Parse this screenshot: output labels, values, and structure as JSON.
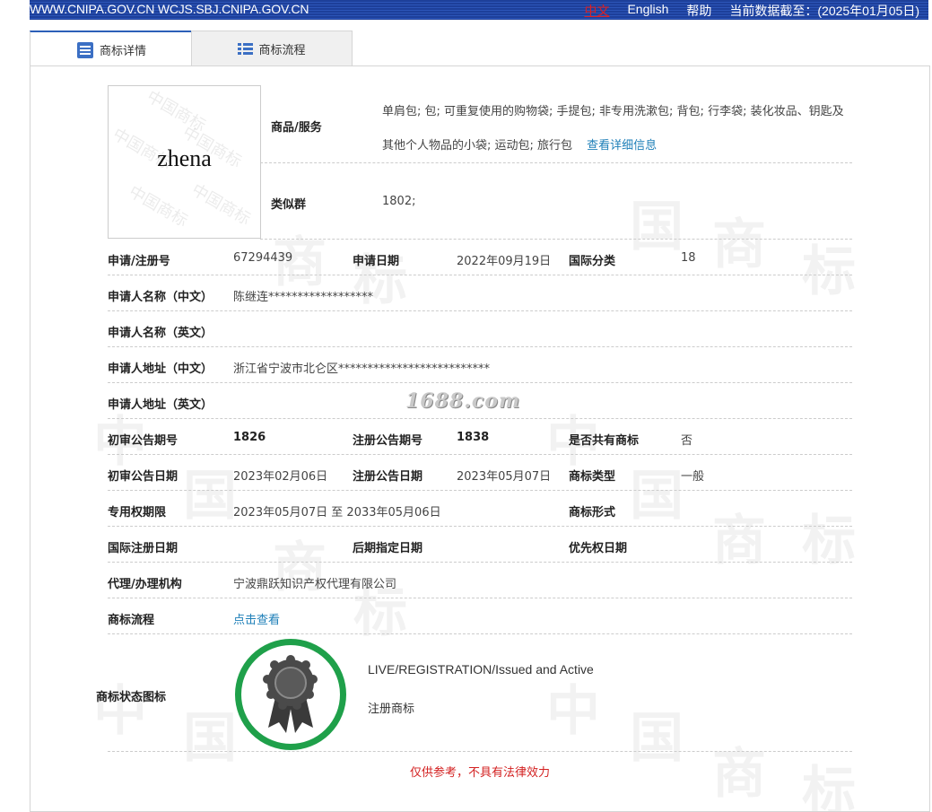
{
  "topbar": {
    "site": "WWW.CNIPA.GOV.CN WCJS.SBJ.CNIPA.GOV.CN",
    "lang_cn": "中文",
    "lang_en": "English",
    "help": "帮助",
    "data_date": "当前数据截至：(2025年01月05日)"
  },
  "tabs": [
    {
      "label": "商标详情",
      "icon": "list-doc-icon",
      "active": true
    },
    {
      "label": "商标流程",
      "icon": "list-bullets-icon",
      "active": false
    }
  ],
  "trademark": {
    "logo_text": "zhena",
    "logo_watermark": "中国商标",
    "goods_label": "商品/服务",
    "goods_value": "单肩包; 包; 可重复使用的购物袋; 手提包; 非专用洗漱包; 背包; 行李袋; 装化妆品、钥匙及其他个人物品的小袋; 运动包; 旅行包",
    "goods_link": "查看详细信息",
    "similar_label": "类似群",
    "similar_value": "1802;"
  },
  "fields": {
    "reg_no_label": "申请/注册号",
    "reg_no": "67294439",
    "apply_date_label": "申请日期",
    "apply_date": "2022年09月19日",
    "intl_class_label": "国际分类",
    "intl_class": "18",
    "applicant_cn_label": "申请人名称（中文）",
    "applicant_cn": "陈继连******************",
    "applicant_en_label": "申请人名称（英文）",
    "applicant_en": "",
    "address_cn_label": "申请人地址（中文）",
    "address_cn": "浙江省宁波市北仑区**************************",
    "address_en_label": "申请人地址（英文）",
    "address_en": "",
    "prelim_no_label": "初审公告期号",
    "prelim_no": "1826",
    "reg_pub_no_label": "注册公告期号",
    "reg_pub_no": "1838",
    "shared_label": "是否共有商标",
    "shared": "否",
    "prelim_date_label": "初审公告日期",
    "prelim_date": "2023年02月06日",
    "reg_pub_date_label": "注册公告日期",
    "reg_pub_date": "2023年05月07日",
    "tm_type_label": "商标类型",
    "tm_type": "一般",
    "term_label": "专用权期限",
    "term": "2023年05月07日 至 2033年05月06日",
    "tm_form_label": "商标形式",
    "tm_form": "",
    "intl_reg_date_label": "国际注册日期",
    "intl_reg_date": "",
    "later_date_label": "后期指定日期",
    "later_date": "",
    "priority_date_label": "优先权日期",
    "priority_date": "",
    "agent_label": "代理/办理机构",
    "agent": "宁波鼎跃知识产权代理有限公司",
    "flow_label": "商标流程",
    "flow_link": "点击查看",
    "status_label": "商标状态图标",
    "status_en": "LIVE/REGISTRATION/Issued and Active",
    "status_cn": "注册商标"
  },
  "watermark_1688": "1688.com",
  "disclaimer": "仅供参考，不具有法律效力",
  "colors": {
    "accent": "#2c5fb8",
    "link": "#1e7fb8",
    "seal_ring": "#1fa04a",
    "disclaimer": "#d32020"
  }
}
